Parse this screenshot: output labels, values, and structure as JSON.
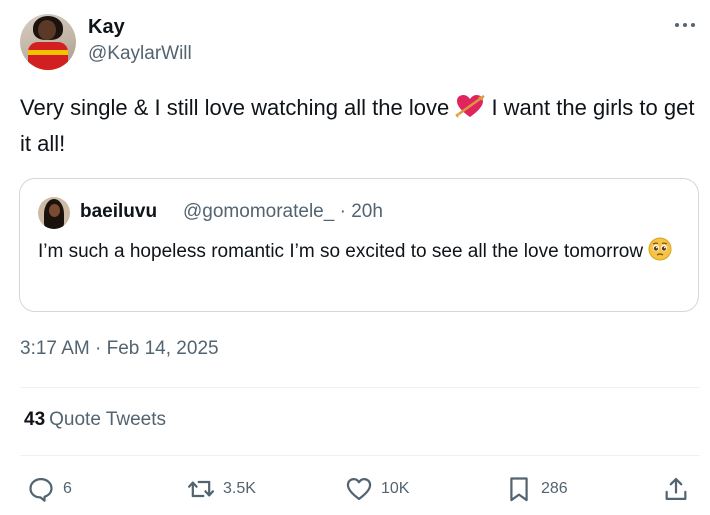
{
  "tweet": {
    "author_name": "Kay",
    "author_handle": "@KaylarWill",
    "text_before_emoji": "Very single & I still love watching all the love ",
    "text_after_emoji": " I want the girls to get it all!"
  },
  "quote": {
    "author_name": "baeiluvu",
    "author_handle": "@gomomoratele_",
    "separator": " · ",
    "time": "20h",
    "text": "I’m such a hopeless romantic I’m so excited to see all the love tomorrow "
  },
  "meta": {
    "timestamp": "3:17 AM · Feb 14, 2025"
  },
  "stats": {
    "quote_tweets_count": "43",
    "quote_tweets_label": "Quote Tweets"
  },
  "actions": {
    "replies": "6",
    "retweets": "3.5K",
    "likes": "10K",
    "bookmarks": "286"
  },
  "icons": {
    "more": "more-icon",
    "reply": "reply-icon",
    "retweet": "retweet-icon",
    "like": "heart-icon",
    "bookmark": "bookmark-icon",
    "share": "share-icon",
    "emoji_tweet": "heart-with-arrow-emoji",
    "emoji_quote": "pleading-face-emoji"
  },
  "colors": {
    "text_primary": "#0f1419",
    "text_secondary": "#536471",
    "border": "#cfd9de"
  }
}
